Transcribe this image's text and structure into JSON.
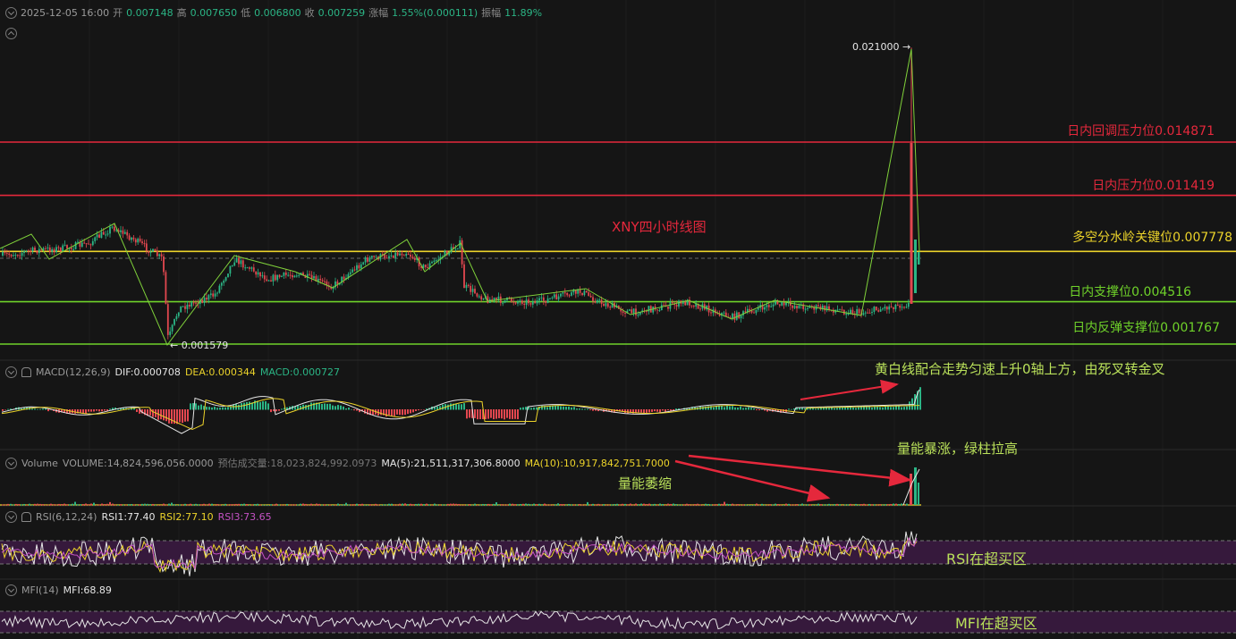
{
  "header": {
    "datetime": "2025-12-05 16:00",
    "open_label": "开",
    "open": "0.007148",
    "high_label": "高",
    "high": "0.007650",
    "low_label": "低",
    "low": "0.006800",
    "close_label": "收",
    "close": "0.007259",
    "change_label": "涨幅",
    "change": "1.55%(0.000111)",
    "amp_label": "振幅",
    "amp": "11.89%"
  },
  "main": {
    "title": "XNY四小时线图",
    "high_marker": "0.021000 →",
    "low_marker": "← 0.001579",
    "levels": [
      {
        "label": "日内回调压力位0.014871",
        "value": 0.014871,
        "color": "#e5283c"
      },
      {
        "label": "日内压力位0.011419",
        "value": 0.011419,
        "color": "#e5283c"
      },
      {
        "label": "多空分水岭关键位0.007778",
        "value": 0.007778,
        "color": "#ecd32a"
      },
      {
        "label": "日内支撑位0.004516",
        "value": 0.004516,
        "color": "#6fd22a"
      },
      {
        "label": "日内反弹支撑位0.001767",
        "value": 0.001767,
        "color": "#6fd22a"
      }
    ]
  },
  "macd": {
    "name": "MACD(12,26,9)",
    "dif": "DIF:0.000708",
    "dea": "DEA:0.000344",
    "macd": "MACD:0.000727",
    "note": "黄白线配合走势匀速上升0轴上方，由死叉转金叉"
  },
  "volume": {
    "name": "Volume",
    "volume": "VOLUME:14,824,596,056.0000",
    "est": "预估成交量:18,023,824,992.0973",
    "ma5": "MA(5):21,511,317,306.8000",
    "ma10": "MA(10):10,917,842,751.7000",
    "note_surge": "量能暴涨，绿柱拉高",
    "note_shrink": "量能萎缩"
  },
  "rsi": {
    "name": "RSI(6,12,24)",
    "rsi1": "RSI1:77.40",
    "rsi2": "RSI2:77.10",
    "rsi3": "RSI3:73.65",
    "note": "RSI在超买区"
  },
  "mfi": {
    "name": "MFI(14)",
    "mfi": "MFI:68.89",
    "note": "MFI在超买区"
  },
  "colors": {
    "up": "#2bb585",
    "down": "#e2474f",
    "red_line": "#e5283c",
    "yellow_line": "#ecd32a",
    "green_line": "#6fd22a",
    "zigzag": "#7fd13a",
    "zone": "#3a1a40"
  }
}
